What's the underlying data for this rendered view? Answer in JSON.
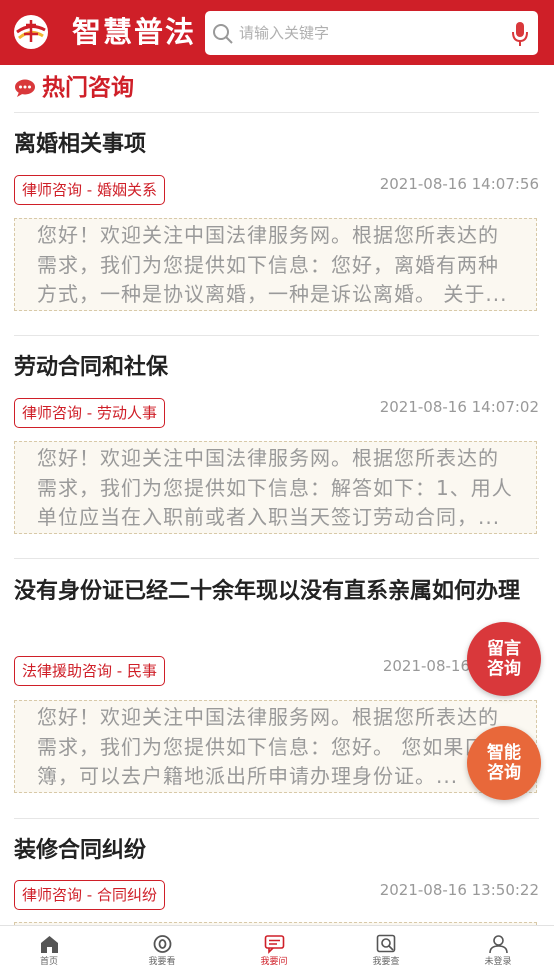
{
  "header": {
    "app_title": "智慧普法",
    "search_placeholder": "请输入关键字",
    "brand_color": "#cf1f28"
  },
  "section": {
    "title": "热门咨询",
    "icon": "chat-bubbles-icon"
  },
  "posts": [
    {
      "title": "离婚相关事项",
      "tag": "律师咨询 - 婚姻关系",
      "time": "2021-08-16 14:07:56",
      "excerpt": "您好！欢迎关注中国法律服务网。根据您所表达的需求，我们为您提供如下信息：您好，离婚有两种方式，一种是协议离婚，一种是诉讼离婚。 关于..."
    },
    {
      "title": "劳动合同和社保",
      "tag": "律师咨询 - 劳动人事",
      "time": "2021-08-16 14:07:02",
      "excerpt": "您好！欢迎关注中国法律服务网。根据您所表达的需求，我们为您提供如下信息：解答如下：1、用人单位应当在入职前或者入职当天签订劳动合同，..."
    },
    {
      "title": "没有身份证已经二十余年现以没有直系亲属如何办理",
      "tag": "法律援助咨询 - 民事",
      "time": "2021-08-16",
      "excerpt": "您好！欢迎关注中国法律服务网。根据您所表达的需求，我们为您提供如下信息：您好。 您如果口簿，可以去户籍地派出所申请办理身份证。..."
    },
    {
      "title": "装修合同纠纷",
      "tag": "律师咨询 - 合同纠纷",
      "time": "2021-08-16 13:50:22",
      "excerpt": ""
    }
  ],
  "fabs": {
    "message": "留言咨询",
    "smart": "智能咨询"
  },
  "nav": [
    {
      "label": "首页",
      "icon": "home-icon",
      "active": false
    },
    {
      "label": "我要看",
      "icon": "eye-icon",
      "active": false
    },
    {
      "label": "我要问",
      "icon": "chat-icon",
      "active": true
    },
    {
      "label": "我要查",
      "icon": "search-doc-icon",
      "active": false
    },
    {
      "label": "未登录",
      "icon": "user-icon",
      "active": false
    }
  ]
}
